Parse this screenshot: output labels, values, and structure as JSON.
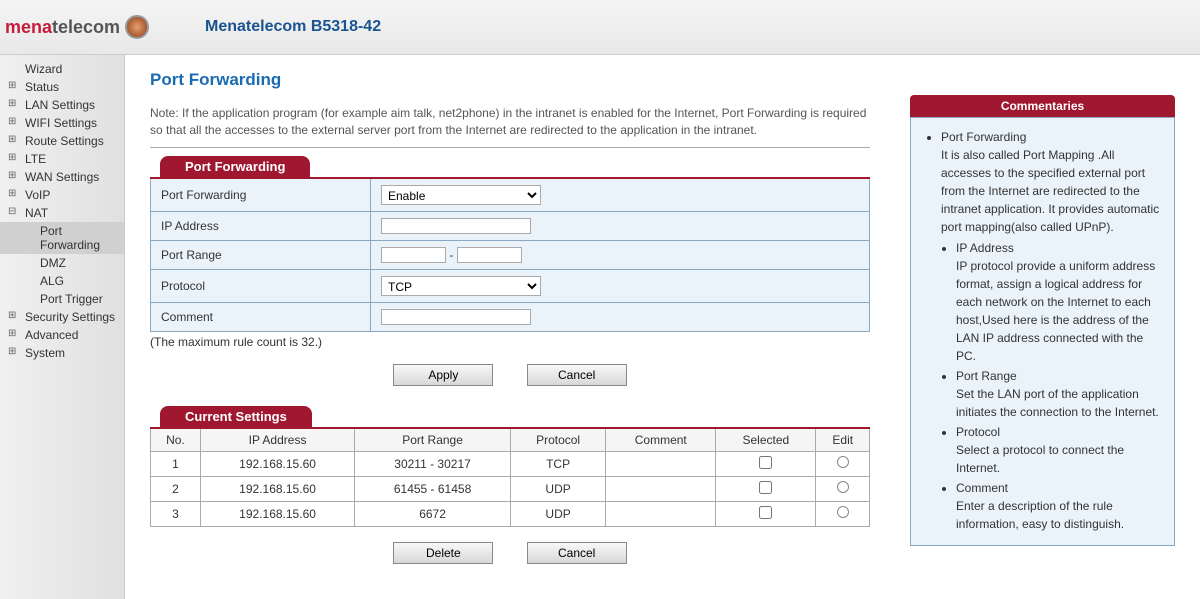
{
  "header": {
    "logo_pre": "mena",
    "logo_post": "telecom",
    "device_title": "Menatelecom B5318-42"
  },
  "sidebar": {
    "items": [
      {
        "label": "Wizard",
        "cls": ""
      },
      {
        "label": "Status",
        "cls": "expandable"
      },
      {
        "label": "LAN Settings",
        "cls": "expandable"
      },
      {
        "label": "WIFI Settings",
        "cls": "expandable"
      },
      {
        "label": "Route Settings",
        "cls": "expandable"
      },
      {
        "label": "LTE",
        "cls": "expandable"
      },
      {
        "label": "WAN Settings",
        "cls": "expandable"
      },
      {
        "label": "VoIP",
        "cls": "expandable"
      },
      {
        "label": "NAT",
        "cls": "expanded"
      }
    ],
    "nat_sub": [
      {
        "label": "Port Forwarding",
        "active": true
      },
      {
        "label": "DMZ",
        "active": false
      },
      {
        "label": "ALG",
        "active": false
      },
      {
        "label": "Port Trigger",
        "active": false
      }
    ],
    "items2": [
      {
        "label": "Security Settings",
        "cls": "expandable"
      },
      {
        "label": "Advanced",
        "cls": "expandable"
      },
      {
        "label": "System",
        "cls": "expandable"
      }
    ]
  },
  "page": {
    "title": "Port Forwarding",
    "note": "Note: If the application program (for example aim talk, net2phone) in the intranet is enabled for the Internet, Port Forwarding is required so that all the accesses to the external server port from the Internet are redirected to the application in the intranet."
  },
  "form": {
    "section_label": "Port Forwarding",
    "fields": {
      "enable": {
        "label": "Port Forwarding",
        "value": "Enable"
      },
      "ip": {
        "label": "IP Address",
        "value": ""
      },
      "port_range": {
        "label": "Port Range",
        "from": "",
        "to": "",
        "sep": "-"
      },
      "protocol": {
        "label": "Protocol",
        "value": "TCP"
      },
      "comment": {
        "label": "Comment",
        "value": ""
      }
    },
    "max_note": "(The maximum rule count is 32.)",
    "apply_btn": "Apply",
    "cancel_btn": "Cancel"
  },
  "table": {
    "section_label": "Current Settings",
    "headers": [
      "No.",
      "IP Address",
      "Port Range",
      "Protocol",
      "Comment",
      "Selected",
      "Edit"
    ],
    "rows": [
      {
        "no": "1",
        "ip": "192.168.15.60",
        "range": "30211 - 30217",
        "proto": "TCP",
        "comment": ""
      },
      {
        "no": "2",
        "ip": "192.168.15.60",
        "range": "61455 - 61458",
        "proto": "UDP",
        "comment": ""
      },
      {
        "no": "3",
        "ip": "192.168.15.60",
        "range": "6672",
        "proto": "UDP",
        "comment": ""
      }
    ],
    "delete_btn": "Delete",
    "cancel_btn": "Cancel"
  },
  "commentary": {
    "title": "Commentaries",
    "heading": "Port Forwarding",
    "intro": "It is also called Port Mapping .All accesses to the specified external port from the Internet are redirected to the intranet application. It provides automatic port mapping(also called UPnP).",
    "items": [
      {
        "t": "IP Address",
        "d": "IP protocol provide a uniform address format, assign a logical address for each network on the Internet to each host,Used here is the address of the LAN IP address connected with the PC."
      },
      {
        "t": "Port Range",
        "d": "Set the LAN port of the application initiates the connection to the Internet."
      },
      {
        "t": "Protocol",
        "d": "Select a protocol to connect the Internet."
      },
      {
        "t": "Comment",
        "d": "Enter a description of the rule information, easy to distinguish."
      }
    ]
  }
}
